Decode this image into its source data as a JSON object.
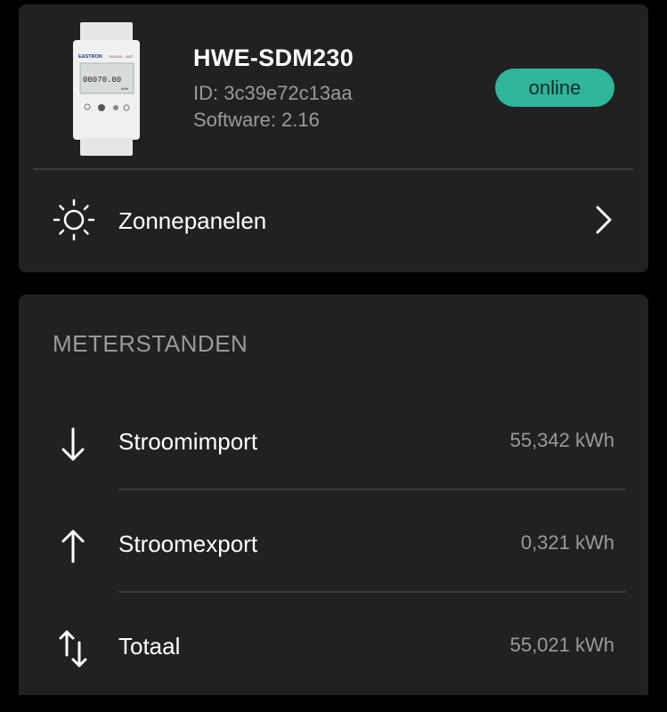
{
  "device": {
    "name": "HWE-SDM230",
    "id": "ID: 3c39e72c13aa",
    "software": "Software: 2.16",
    "status": "online",
    "meter_brand": "EASTRON",
    "meter_model": "SDM230 - MBT",
    "meter_display": "00070.00",
    "meter_unit": "kWh"
  },
  "nav": {
    "label": "Zonnepanelen",
    "icon": "sun-icon"
  },
  "meterstanden": {
    "title": "METERSTANDEN",
    "rows": [
      {
        "icon": "arrow-down-icon",
        "label": "Stroomimport",
        "value": "55,342 kWh"
      },
      {
        "icon": "arrow-up-icon",
        "label": "Stroomexport",
        "value": "0,321 kWh"
      },
      {
        "icon": "arrows-updown-icon",
        "label": "Totaal",
        "value": "55,021 kWh"
      }
    ]
  },
  "colors": {
    "background": "#000000",
    "card": "#212121",
    "accent": "#2fb59a",
    "muted_text": "#9a9a9a",
    "divider": "#3a3a3a"
  }
}
